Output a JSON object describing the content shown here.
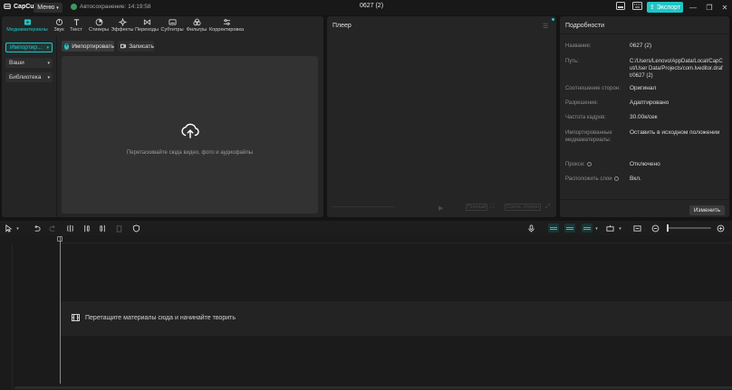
{
  "titlebar": {
    "app_name": "CapCut",
    "menu_label": "Меню",
    "autosave": "Автосохранение: 14:19:58",
    "project_title": "0627 (2)",
    "export_label": "Экспорт"
  },
  "tabs": [
    {
      "label": "Медиаматериалы",
      "icon": "media-icon",
      "active": true
    },
    {
      "label": "Звук",
      "icon": "audio-icon"
    },
    {
      "label": "Текст",
      "icon": "text-icon"
    },
    {
      "label": "Стикеры",
      "icon": "sticker-icon"
    },
    {
      "label": "Эффекты",
      "icon": "effects-icon"
    },
    {
      "label": "Переходы",
      "icon": "transitions-icon"
    },
    {
      "label": "Субтитры",
      "icon": "subtitles-icon"
    },
    {
      "label": "Фильтры",
      "icon": "filters-icon"
    },
    {
      "label": "Корректировка",
      "icon": "adjust-icon"
    }
  ],
  "sidebar": {
    "items": [
      {
        "label": "Импортир..."
      },
      {
        "label": "Ваши"
      },
      {
        "label": "Библиотека"
      }
    ]
  },
  "media": {
    "import_label": "Импортировать",
    "record_label": "Записать",
    "drop_text": "Перетаскивайте сюда видео, фото и аудиофайлы"
  },
  "player": {
    "title": "Плеер",
    "full_label": "Полный",
    "ratio_label": "Соотн. сторон"
  },
  "details": {
    "title": "Подробности",
    "rows": [
      {
        "label": "Название:",
        "value": "0627 (2)"
      },
      {
        "label": "Путь:",
        "value": "C:/Users/Lenovo/AppData/Local/CapCut/User Data/Projects/com.lveditor.draft/0627 (2)"
      },
      {
        "label": "Соотношение сторон:",
        "value": "Оригинал"
      },
      {
        "label": "Разрешение:",
        "value": "Адаптировано"
      },
      {
        "label": "Частота кадров:",
        "value": "30.00к/сек"
      },
      {
        "label": "Импортированные медиаматериалы:",
        "value": "Оставить в исходном положении"
      },
      {
        "label": "Прокси:",
        "value": "Отключено"
      },
      {
        "label": "Расположить слои",
        "value": "Вкл."
      }
    ],
    "change_label": "Изменить"
  },
  "timeline": {
    "track_hint": "Перетащите материалы сюда и начинайте творить"
  },
  "colors": {
    "accent": "#21c5c6",
    "panel": "#252525",
    "background": "#141414"
  }
}
